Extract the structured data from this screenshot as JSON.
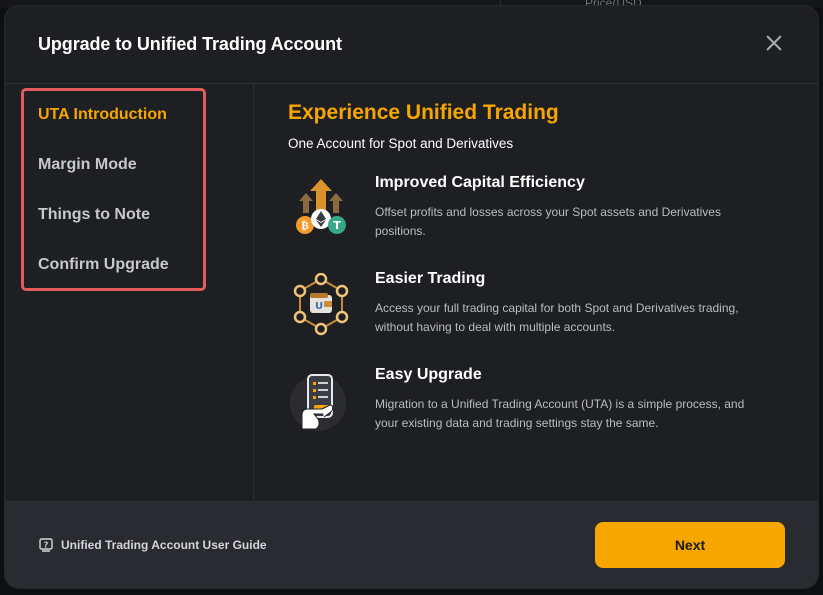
{
  "background": {
    "peek_text": "Price(USD..."
  },
  "modal": {
    "title": "Upgrade to Unified Trading Account"
  },
  "sidebar": {
    "items": [
      {
        "label": "UTA Introduction",
        "active": true
      },
      {
        "label": "Margin Mode",
        "active": false
      },
      {
        "label": "Things to Note",
        "active": false
      },
      {
        "label": "Confirm Upgrade",
        "active": false
      }
    ]
  },
  "content": {
    "title": "Experience Unified Trading",
    "subtitle": "One Account for Spot and Derivatives",
    "features": [
      {
        "icon": "capital-efficiency-icon",
        "title": "Improved Capital Efficiency",
        "description": "Offset profits and losses across your Spot assets and Derivatives positions."
      },
      {
        "icon": "wallet-network-icon",
        "title": "Easier Trading",
        "description": "Access your full trading capital for both Spot and Derivatives trading, without having to deal with multiple accounts."
      },
      {
        "icon": "phone-checklist-icon",
        "title": "Easy Upgrade",
        "description": "Migration to a Unified Trading Account (UTA) is a simple process, and your existing data and trading settings stay the same."
      }
    ]
  },
  "footer": {
    "guide_label": "Unified Trading Account User Guide",
    "next_label": "Next"
  },
  "colors": {
    "accent": "#f7a600",
    "modal_bg": "#1e1f23",
    "footer_bg": "#2a2b30",
    "highlight_border": "#e35b5b"
  }
}
